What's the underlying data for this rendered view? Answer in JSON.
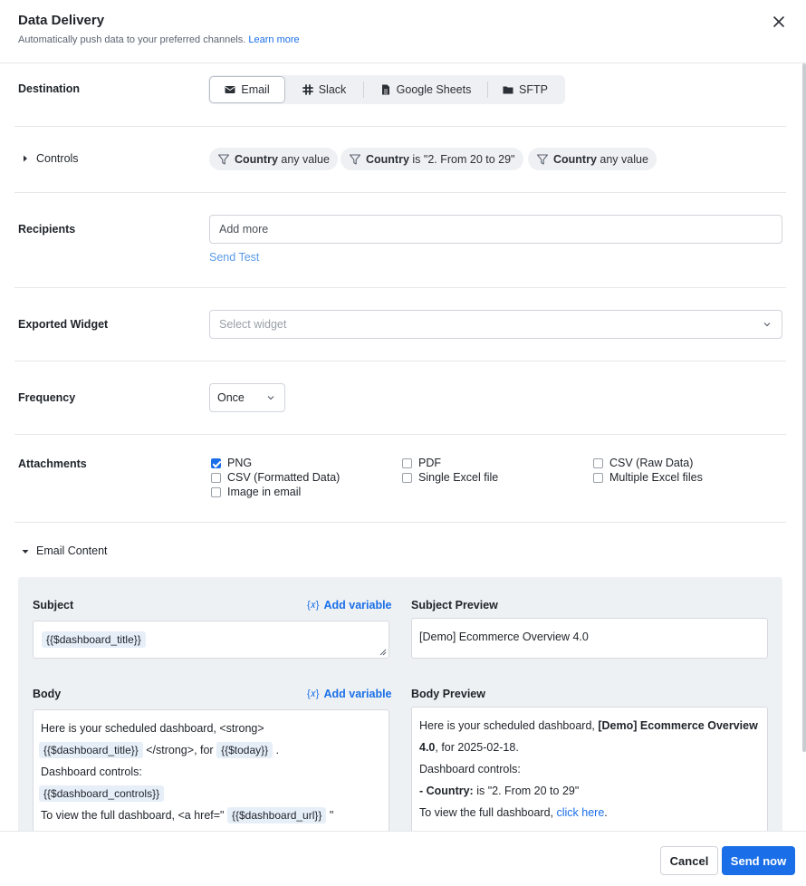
{
  "header": {
    "title": "Data Delivery",
    "subtitle": "Automatically push data to your preferred channels.",
    "learn_more": "Learn more"
  },
  "destination": {
    "label": "Destination",
    "options": [
      {
        "label": "Email",
        "icon": "mail-icon",
        "active": true
      },
      {
        "label": "Slack",
        "icon": "slack-icon",
        "active": false
      },
      {
        "label": "Google Sheets",
        "icon": "sheet-icon",
        "active": false
      },
      {
        "label": "SFTP",
        "icon": "folder-icon",
        "active": false
      }
    ]
  },
  "controls": {
    "label": "Controls",
    "filters": [
      {
        "field": "Country",
        "condition": "any value"
      },
      {
        "field": "Country",
        "condition": "is \"2. From 20 to 29\""
      },
      {
        "field": "Country",
        "condition": "any value"
      }
    ]
  },
  "recipients": {
    "label": "Recipients",
    "placeholder": "Add more",
    "send_test": "Send Test"
  },
  "exported_widget": {
    "label": "Exported Widget",
    "placeholder": "Select widget"
  },
  "frequency": {
    "label": "Frequency",
    "value": "Once"
  },
  "attachments": {
    "label": "Attachments",
    "options": [
      {
        "label": "PNG",
        "checked": true
      },
      {
        "label": "PDF",
        "checked": false
      },
      {
        "label": "CSV (Raw Data)",
        "checked": false
      },
      {
        "label": "CSV (Formatted Data)",
        "checked": false
      },
      {
        "label": "Single Excel file",
        "checked": false
      },
      {
        "label": "Multiple Excel files",
        "checked": false
      },
      {
        "label": "Image in email",
        "checked": false
      }
    ]
  },
  "email_content": {
    "label": "Email Content",
    "subject_label": "Subject",
    "add_variable": "Add variable",
    "subject_token": "{{$dashboard_title}}",
    "subject_preview_label": "Subject Preview",
    "subject_preview": "[Demo] Ecommerce Overview 4.0",
    "body_label": "Body",
    "body_preview_label": "Body Preview",
    "body": {
      "line1": "Here is your scheduled dashboard, <strong>",
      "token_title": "{{$dashboard_title}}",
      "strong_close_for": "</strong>, for",
      "token_today": "{{$today}}",
      "period": ".",
      "controls_line": "Dashboard controls:",
      "token_controls": "{{$dashboard_controls}}",
      "view_line": "To view the full dashboard, <a href=\"",
      "token_url": "{{$dashboard_url}}",
      "quote": "\""
    },
    "body_preview": {
      "intro": "Here is your scheduled dashboard,",
      "title_bold_1": "[Demo] Ecommerce Overview",
      "title_bold_2": "4.0",
      "date_text": ", for 2025-02-18.",
      "controls_line": "Dashboard controls:",
      "control_field": "- Country:",
      "control_value": "is \"2. From 20 to 29\"",
      "view_text": "To view the full dashboard,",
      "click_here": "click here",
      "end_period": "."
    }
  },
  "footer": {
    "cancel": "Cancel",
    "send_now": "Send now"
  },
  "colors": {
    "accent": "#1a6fe8",
    "panel_bg": "#eef1f4",
    "chip_bg": "#eef0f3"
  }
}
